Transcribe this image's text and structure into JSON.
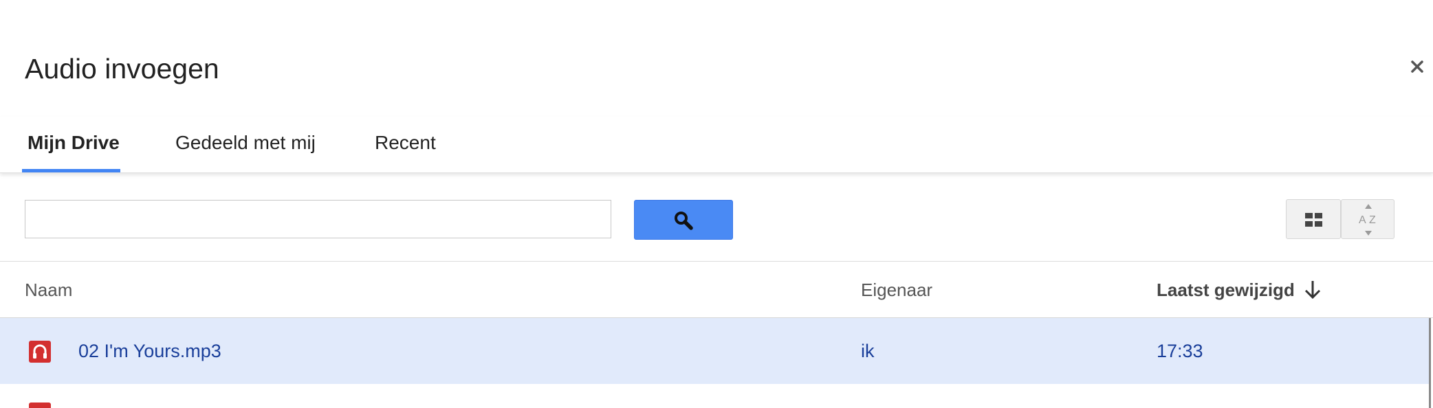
{
  "dialog": {
    "title": "Audio invoegen",
    "close_label": "×"
  },
  "tabs": [
    {
      "label": "Mijn Drive",
      "active": true
    },
    {
      "label": "Gedeeld met mij",
      "active": false
    },
    {
      "label": "Recent",
      "active": false
    }
  ],
  "search": {
    "value": "",
    "placeholder": "",
    "button_icon": "search-icon"
  },
  "view_controls": {
    "grid_icon": "grid-view-icon",
    "sort_icon": "sort-az-icon"
  },
  "columns": {
    "name": "Naam",
    "owner": "Eigenaar",
    "modified": "Laatst gewijzigd",
    "sort_direction": "descending"
  },
  "files": [
    {
      "name": "02 I'm Yours.mp3",
      "owner": "ik",
      "modified": "17:33",
      "selected": true,
      "icon": "audio-file-icon"
    }
  ],
  "colors": {
    "accent": "#4285f4",
    "search_button": "#4a8af4",
    "selected_row": "#e1eafb",
    "link_text": "#1a3f9a",
    "audio_icon": "#d32f2f"
  }
}
